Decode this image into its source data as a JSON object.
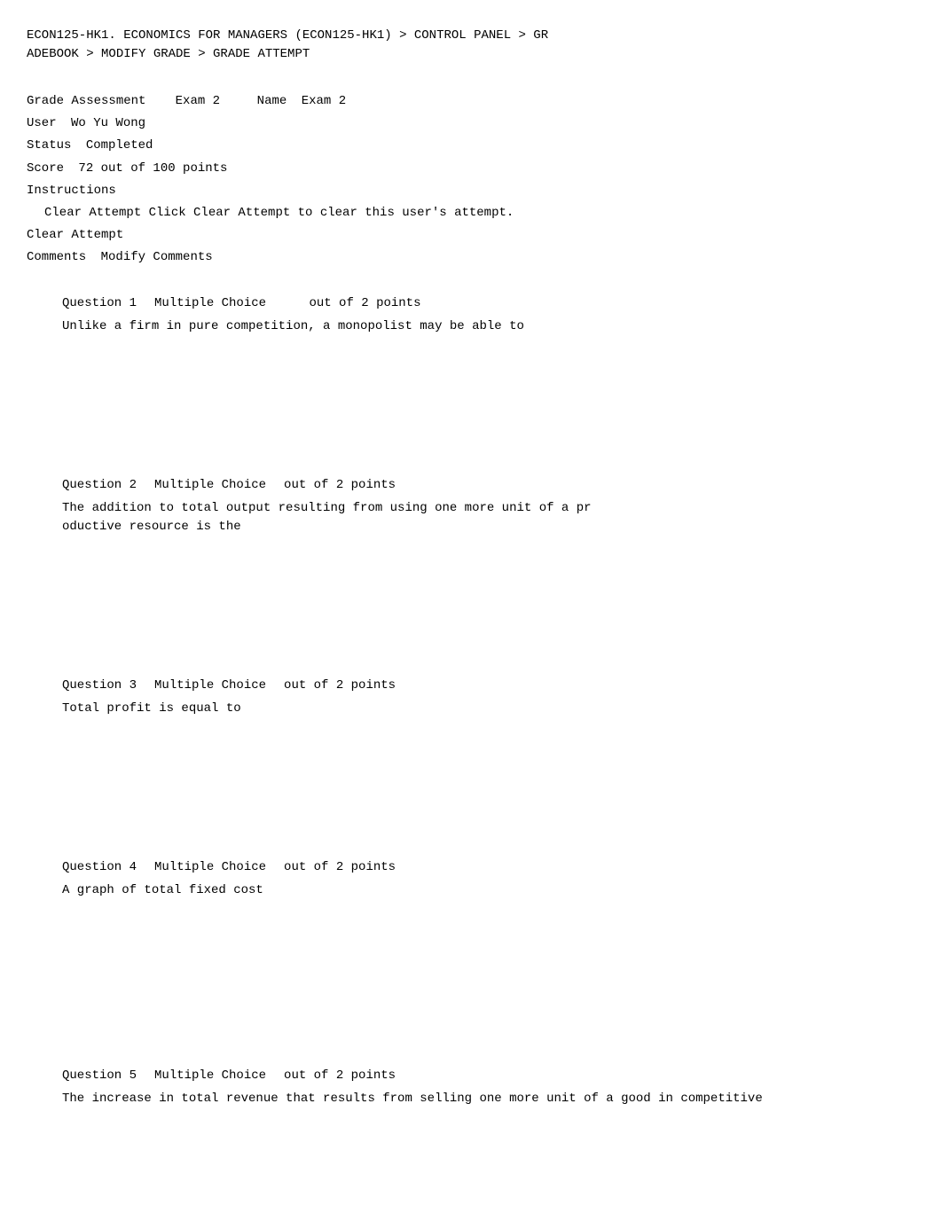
{
  "breadcrumb": {
    "line1": " ECON125-HK1. ECONOMICS FOR MANAGERS (ECON125-HK1) > CONTROL PANEL > GR",
    "line2": "ADEBOOK > MODIFY GRADE > GRADE ATTEMPT"
  },
  "grade_info": {
    "assessment_label": "Grade Assessment",
    "assessment_value": "Exam 2",
    "name_label": "Name",
    "name_value": "Exam 2",
    "user_label": "User",
    "user_value": "Wo Yu Wong",
    "status_label": "Status",
    "status_value": "Completed",
    "score_label": "Score",
    "score_value": "72 out of 100 points",
    "instructions_label": "Instructions",
    "instructions_text": "Clear Attempt Click Clear Attempt to clear this user's attempt.",
    "clear_label": "Clear Attempt",
    "comments_label": "Comments",
    "comments_value": "Modify Comments"
  },
  "questions": [
    {
      "number": "Question 1",
      "type": "Multiple Choice",
      "points": "out of 2 points",
      "text": "Unlike a firm in pure competition, a monopolist may be able to"
    },
    {
      "number": "Question 2",
      "type": "Multiple Choice",
      "points": "out of 2 points",
      "text": "The addition to total output resulting from using one more unit of a pr\noductive resource is the"
    },
    {
      "number": "Question 3",
      "type": "Multiple Choice",
      "points": "out of 2 points",
      "text": "Total profit is equal to"
    },
    {
      "number": "Question 4",
      "type": "Multiple Choice",
      "points": "out of 2 points",
      "text": "A graph of total fixed cost"
    },
    {
      "number": "Question 5",
      "type": "Multiple Choice",
      "points": "out of 2 points",
      "text": "The increase in total revenue that results from selling one more unit of a good in competitive"
    }
  ]
}
